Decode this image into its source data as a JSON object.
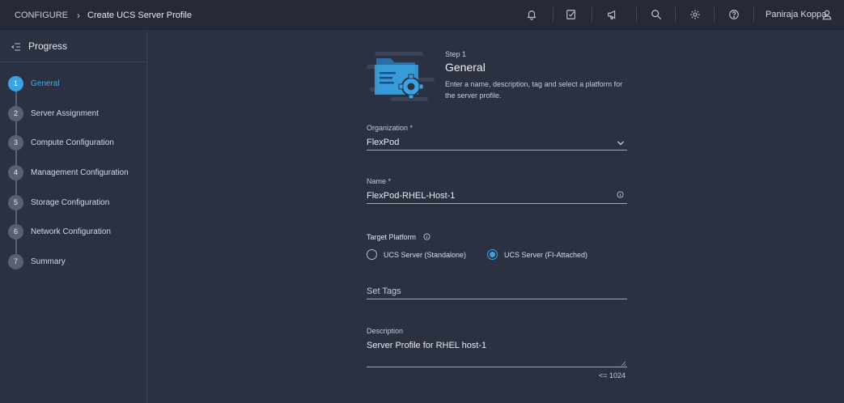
{
  "header": {
    "section": "CONFIGURE",
    "page_title": "Create UCS Server Profile",
    "user_name": "Paniraja Koppa",
    "icons": [
      "bell-icon",
      "task-check-icon",
      "megaphone-icon",
      "search-icon",
      "gear-icon",
      "help-icon",
      "user-icon"
    ]
  },
  "sidebar": {
    "title": "Progress",
    "steps": [
      {
        "num": "1",
        "label": "General",
        "active": true
      },
      {
        "num": "2",
        "label": "Server Assignment"
      },
      {
        "num": "3",
        "label": "Compute Configuration"
      },
      {
        "num": "4",
        "label": "Management Configuration"
      },
      {
        "num": "5",
        "label": "Storage Configuration"
      },
      {
        "num": "6",
        "label": "Network Configuration"
      },
      {
        "num": "7",
        "label": "Summary"
      }
    ]
  },
  "main": {
    "step_label": "Step 1",
    "step_title": "General",
    "step_description": "Enter a name, description, tag and select a platform for the server profile.",
    "organization": {
      "label": "Organization *",
      "value": "FlexPod"
    },
    "name": {
      "label": "Name *",
      "value": "FlexPod-RHEL-Host-1"
    },
    "target_platform": {
      "label": "Target Platform",
      "options": [
        "UCS Server (Standalone)",
        "UCS Server (FI-Attached)"
      ],
      "selected": "UCS Server (FI-Attached)"
    },
    "tags": {
      "placeholder": "Set Tags"
    },
    "description": {
      "label": "Description",
      "value": "Server Profile for RHEL host-1",
      "counter": "<= 1024"
    }
  },
  "colors": {
    "accent": "#3aa3e3",
    "background": "#2c3142",
    "topbar": "#262a38"
  }
}
